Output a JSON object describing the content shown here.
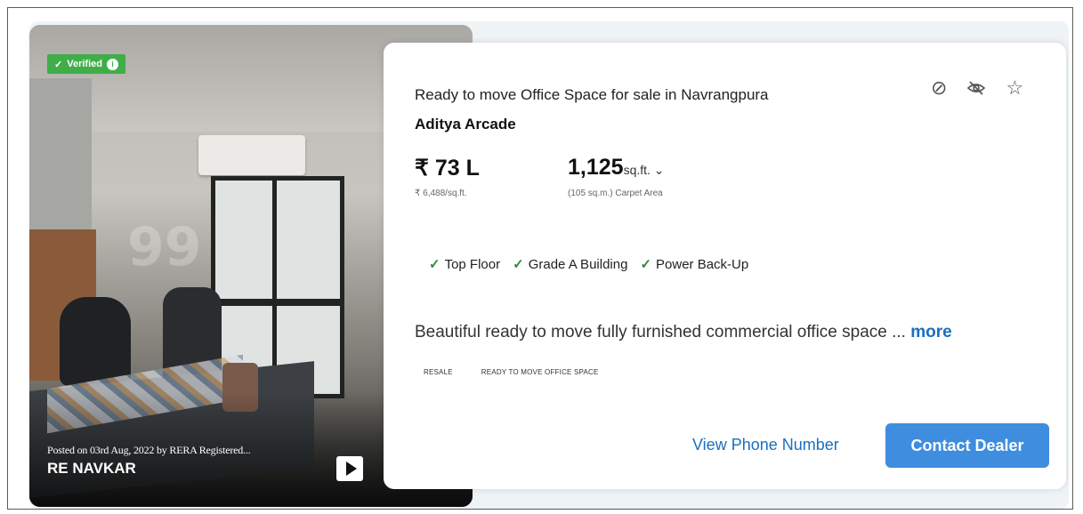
{
  "listing": {
    "badge": "Verified",
    "badge_info": "i",
    "posted_text": "Posted on 03rd Aug, 2022 by RERA Registered...",
    "dealer_name": "RE NAVKAR",
    "title": "Ready to move Office Space for sale in Navrangpura",
    "project_name": "Aditya Arcade",
    "price": "₹ 73 L",
    "price_per_sqft": "₹ 6,488/sq.ft.",
    "area_value": "1,125",
    "area_unit": "sq.ft. ⌄",
    "area_sub": "(105 sq.m.) Carpet Area",
    "features": [
      "Top Floor",
      "Grade A Building",
      "Power Back-Up"
    ],
    "description": "Beautiful ready to move fully furnished commercial office space ...",
    "more_label": "more",
    "tags": [
      "RESALE",
      "READY TO MOVE OFFICE SPACE"
    ],
    "view_phone_label": "View Phone Number",
    "contact_label": "Contact Dealer"
  },
  "icons": [
    "hide-listing-icon",
    "eye-slash-icon",
    "star-icon",
    "play-icon",
    "check-icon"
  ],
  "colors": {
    "accent": "#3e8dde",
    "link": "#1a6fc0",
    "verified": "#3fae49",
    "tick": "#2e8b3a"
  }
}
